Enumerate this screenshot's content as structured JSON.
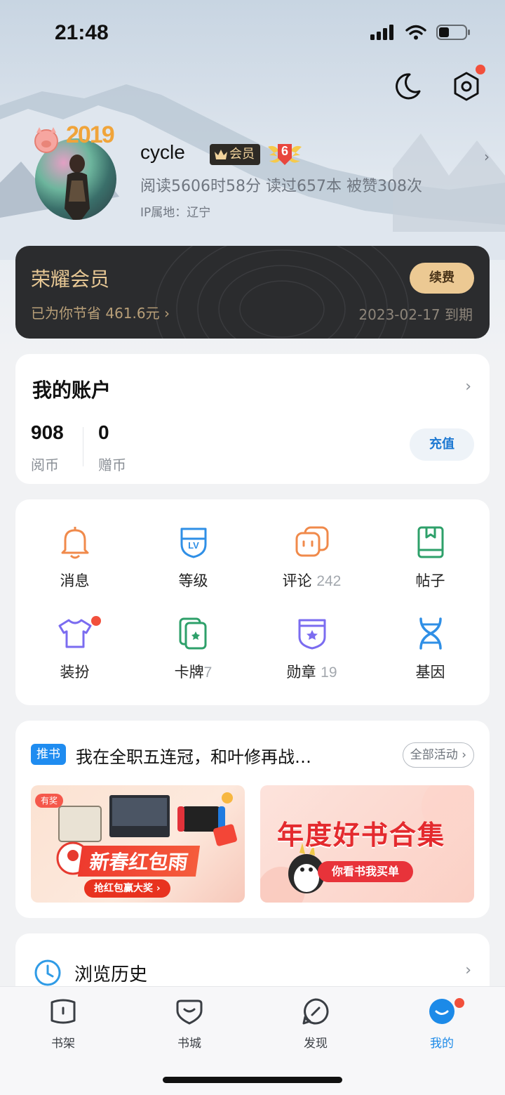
{
  "status_bar": {
    "time": "21:48"
  },
  "profile": {
    "username": "cycle",
    "vip_tag": "会员",
    "level": "6",
    "avatar_badge": "2019",
    "stats": "阅读5606时58分  读过657本  被赞308次",
    "ip_location": "IP属地：辽宁"
  },
  "vip_card": {
    "title": "荣耀会员",
    "savings": "已为你节省 461.6元  ›",
    "renew_label": "续费",
    "expiry": "2023-02-17 到期"
  },
  "account": {
    "title": "我的账户",
    "coins_value": "908",
    "coins_label": "阅币",
    "gift_value": "0",
    "gift_label": "赠币",
    "recharge_label": "充值"
  },
  "menu": {
    "items": [
      {
        "label": "消息",
        "count": ""
      },
      {
        "label": "等级",
        "count": ""
      },
      {
        "label": "评论",
        "count": "242"
      },
      {
        "label": "帖子",
        "count": ""
      },
      {
        "label": "装扮",
        "count": ""
      },
      {
        "label": "卡牌",
        "count": "7"
      },
      {
        "label": "勋章",
        "count": "19"
      },
      {
        "label": "基因",
        "count": ""
      }
    ]
  },
  "activity": {
    "tag": "推书",
    "title": "我在全职五连冠，和叶修再战…",
    "all_label": "全部活动 ›",
    "banner1_hot": "有奖",
    "banner1_title": "新春红包雨",
    "banner1_sub": "抢红包赢大奖 ›",
    "banner2_title": "年度好书合集",
    "banner2_sub": "你看书我买单"
  },
  "history": {
    "title": "浏览历史"
  },
  "tabs": [
    {
      "label": "书架"
    },
    {
      "label": "书城"
    },
    {
      "label": "发现"
    },
    {
      "label": "我的"
    }
  ],
  "colors": {
    "accent": "#1c8ae8",
    "vip_gold": "#e9c995",
    "notification_red": "#f2503c"
  }
}
